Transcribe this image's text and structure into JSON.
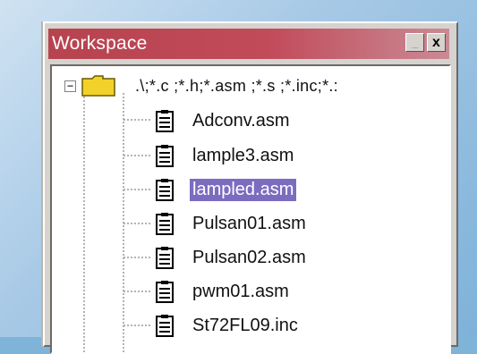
{
  "window": {
    "title": "Workspace",
    "buttons": {
      "minimize": "_",
      "close": "x"
    }
  },
  "colors": {
    "titlebar": "#c24b5a",
    "selection": "#7c6cc0",
    "panel": "#ffffff"
  },
  "tree": {
    "expander": "−",
    "root": {
      "icon": "folder-icon",
      "label": ".\\;*.c ;*.h;*.asm ;*.s ;*.inc;*.:"
    },
    "files": [
      {
        "label": "Adconv.asm",
        "icon": "file-icon",
        "selected": false
      },
      {
        "label": "lample3.asm",
        "icon": "file-icon",
        "selected": false
      },
      {
        "label": "lampled.asm",
        "icon": "file-icon",
        "selected": true
      },
      {
        "label": "Pulsan01.asm",
        "icon": "file-icon",
        "selected": false
      },
      {
        "label": "Pulsan02.asm",
        "icon": "file-icon",
        "selected": false
      },
      {
        "label": "pwm01.asm",
        "icon": "file-icon",
        "selected": false
      },
      {
        "label": "St72FL09.inc",
        "icon": "file-icon",
        "selected": false
      }
    ]
  }
}
